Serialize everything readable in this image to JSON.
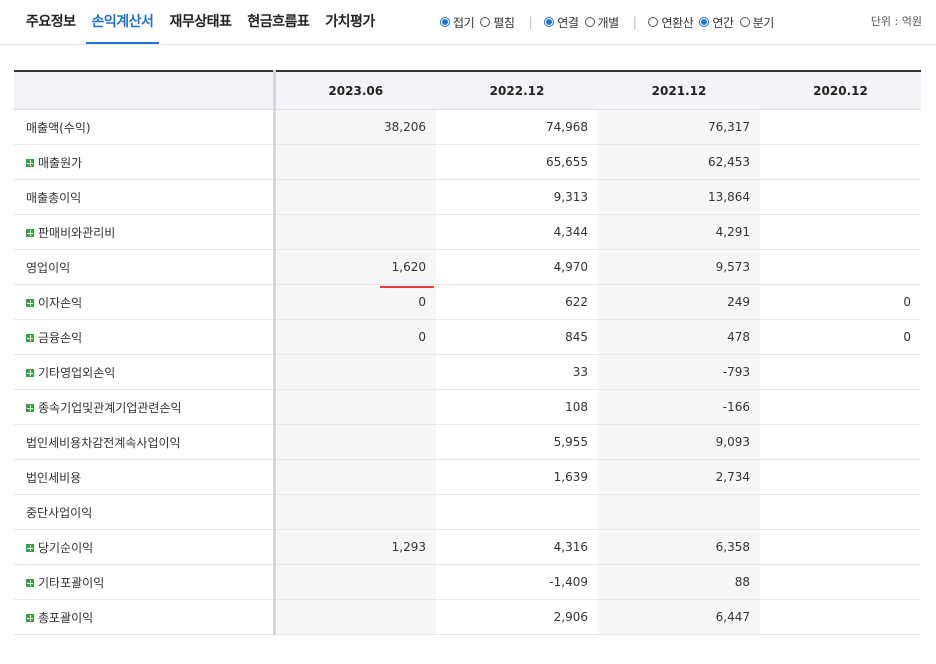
{
  "tabs": [
    {
      "label": "주요정보",
      "active": false
    },
    {
      "label": "손익계산서",
      "active": true
    },
    {
      "label": "재무상태표",
      "active": false
    },
    {
      "label": "현금흐름표",
      "active": false
    },
    {
      "label": "가치평가",
      "active": false
    }
  ],
  "options": {
    "group1": [
      {
        "label": "접기",
        "checked": true
      },
      {
        "label": "펼침",
        "checked": false
      }
    ],
    "group2": [
      {
        "label": "연결",
        "checked": true
      },
      {
        "label": "개별",
        "checked": false
      }
    ],
    "group3": [
      {
        "label": "연환산",
        "checked": false
      },
      {
        "label": "연간",
        "checked": true
      },
      {
        "label": "분기",
        "checked": false
      }
    ]
  },
  "unit": "단위 : 억원",
  "table": {
    "headers": [
      "",
      "2023.06",
      "2022.12",
      "2021.12",
      "2020.12"
    ],
    "rows": [
      {
        "label": "매출액(수익)",
        "expandable": false,
        "values": [
          "38,206",
          "74,968",
          "76,317",
          ""
        ]
      },
      {
        "label": "매출원가",
        "expandable": true,
        "values": [
          "",
          "65,655",
          "62,453",
          ""
        ]
      },
      {
        "label": "매출총이익",
        "expandable": false,
        "values": [
          "",
          "9,313",
          "13,864",
          ""
        ]
      },
      {
        "label": "판매비와관리비",
        "expandable": true,
        "values": [
          "",
          "4,344",
          "4,291",
          ""
        ]
      },
      {
        "label": "영업이익",
        "expandable": false,
        "values": [
          "1,620",
          "4,970",
          "9,573",
          ""
        ]
      },
      {
        "label": "이자손익",
        "expandable": true,
        "values": [
          "0",
          "622",
          "249",
          "0"
        ]
      },
      {
        "label": "금융손익",
        "expandable": true,
        "values": [
          "0",
          "845",
          "478",
          "0"
        ]
      },
      {
        "label": "기타영업외손익",
        "expandable": true,
        "values": [
          "",
          "33",
          "-793",
          ""
        ]
      },
      {
        "label": "종속기업및관계기업관련손익",
        "expandable": true,
        "values": [
          "",
          "108",
          "-166",
          ""
        ]
      },
      {
        "label": "법인세비용차감전계속사업이익",
        "expandable": false,
        "values": [
          "",
          "5,955",
          "9,093",
          ""
        ]
      },
      {
        "label": "법인세비용",
        "expandable": false,
        "values": [
          "",
          "1,639",
          "2,734",
          ""
        ]
      },
      {
        "label": "중단사업이익",
        "expandable": false,
        "values": [
          "",
          "",
          "",
          ""
        ]
      },
      {
        "label": "당기순이익",
        "expandable": true,
        "values": [
          "1,293",
          "4,316",
          "6,358",
          ""
        ]
      },
      {
        "label": "기타포괄이익",
        "expandable": true,
        "values": [
          "",
          "-1,409",
          "88",
          ""
        ]
      },
      {
        "label": "총포괄이익",
        "expandable": true,
        "values": [
          "",
          "2,906",
          "6,447",
          ""
        ]
      }
    ]
  },
  "colors": {
    "accent": "#1f74d6",
    "expand_icon": "#3aa04a",
    "highlight": "#e03a3a"
  }
}
